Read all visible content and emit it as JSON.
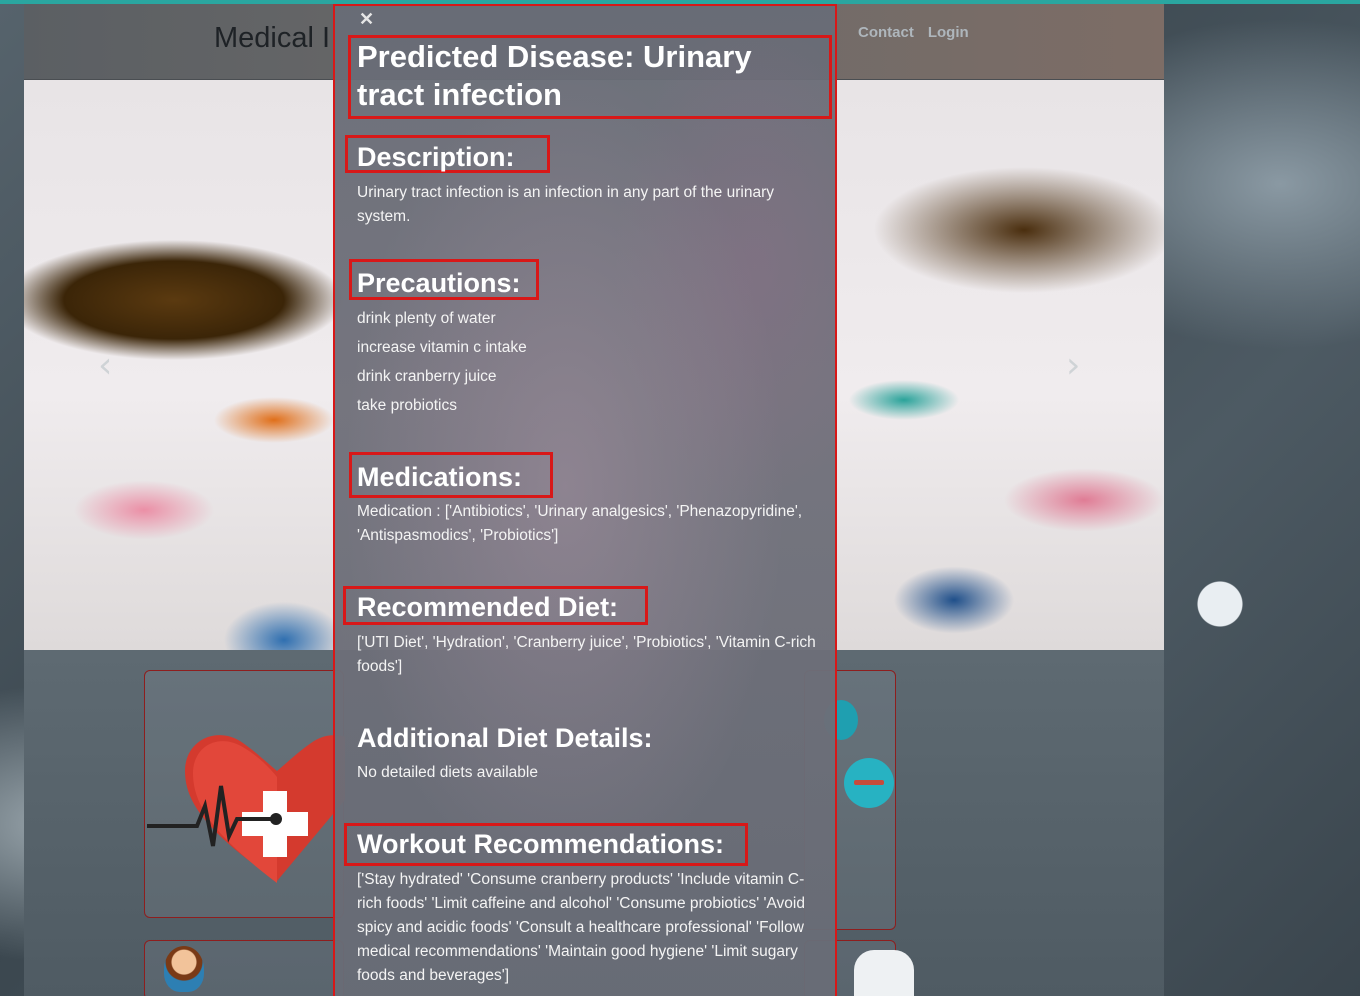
{
  "site": {
    "brand": "Medical I",
    "nav": [
      "Contact",
      "Login"
    ],
    "carousel": {
      "prev_glyph": "‹",
      "next_glyph": "›"
    }
  },
  "modal": {
    "close_glyph": "✕",
    "title": "Predicted Disease: Urinary tract infection",
    "description": {
      "heading": "Description:",
      "text": "Urinary tract infection is an infection in any part of the urinary system."
    },
    "precautions": {
      "heading": "Precautions:",
      "items": [
        "drink plenty of water",
        "increase vitamin c intake",
        "drink cranberry juice",
        "take probiotics"
      ]
    },
    "medications": {
      "heading": "Medications:",
      "text": "Medication : ['Antibiotics', 'Urinary analgesics', 'Phenazopyridine', 'Antispasmodics', 'Probiotics']"
    },
    "diet": {
      "heading": "Recommended Diet:",
      "text": "['UTI Diet', 'Hydration', 'Cranberry juice', 'Probiotics', 'Vitamin C-rich foods']"
    },
    "additional_diet": {
      "heading": "Additional Diet Details:",
      "text": "No detailed diets available"
    },
    "workout": {
      "heading": "Workout Recommendations:",
      "text": "['Stay hydrated' 'Consume cranberry products' 'Include vitamin C-rich foods' 'Limit caffeine and alcohol' 'Consume probiotics' 'Avoid spicy and acidic foods' 'Consult a healthcare professional' 'Follow medical recommendations' 'Maintain good hygiene' 'Limit sugary foods and beverages']"
    }
  },
  "colors": {
    "highlight": "#d81818",
    "modal_bg": "#6c6e78",
    "accent_strip": "#2aa6a0"
  },
  "icons": [
    "close-icon",
    "chevron-left-icon",
    "chevron-right-icon",
    "heart-medical-icon",
    "doctor-avatar-icon",
    "syringe-icon"
  ]
}
